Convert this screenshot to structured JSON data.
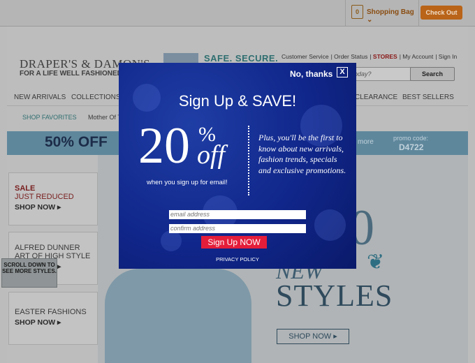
{
  "header": {
    "bag_count": "0",
    "bag_label": "Shopping Bag",
    "checkout_label": "Check Out"
  },
  "brand": {
    "logo": "DRAPER'S & DAMON'S",
    "tagline": "FOR A LIFE WELL FASHIONED®",
    "safe_secure": "SAFE. SECURE."
  },
  "utility_links": [
    "Customer Service",
    "Order Status",
    "STORES",
    "My Account",
    "Sign In"
  ],
  "search": {
    "placeholder": "oday?",
    "button": "Search"
  },
  "main_nav": {
    "left": [
      "NEW ARRIVALS",
      "COLLECTIONS"
    ],
    "right": [
      "CLEARANCE",
      "BEST SELLERS"
    ]
  },
  "sub_nav": [
    "SHOP FAVORITES",
    "Mother Of T"
  ],
  "promo": {
    "headline": "50% OFF",
    "more": "more",
    "code_label": "promo code:",
    "code": "D4722"
  },
  "tiles": [
    {
      "line1": "SALE",
      "line2": "JUST REDUCED",
      "cta": "SHOP NOW ▸"
    },
    {
      "line1": "ALFRED DUNNER",
      "line2": "ART OF HIGH STYLE",
      "cta": "SHOP NOW ▸"
    },
    {
      "line1": "EASTER FASHIONS",
      "line2": "",
      "cta": "SHOP NOW ▸"
    }
  ],
  "scroll_tip": "SCROLL DOWN TO SEE MORE STYLES.",
  "hero": {
    "big": "0",
    "new_word": "NEW",
    "styles": "STYLES",
    "shop_now": "SHOP NOW ▸"
  },
  "modal": {
    "no_thanks": "No, thanks",
    "close": "X",
    "title": "Sign Up & SAVE!",
    "percent": "20",
    "percent_sign": "%",
    "off": "off",
    "when": "when you sign up for email!",
    "plus_text": "Plus, you'll be the first to know about new arrivals, fashion trends, specials and exclusive promotions.",
    "email_placeholder": "email address",
    "confirm_placeholder": "confirm address",
    "submit": "Sign Up NOW",
    "privacy": "PRIVACY POLICY"
  },
  "colors": {
    "modal_bg": "#10268a",
    "submit_bg": "#e41d3a",
    "checkout_bg": "#b96418",
    "promo_bg": "#5f879c"
  }
}
